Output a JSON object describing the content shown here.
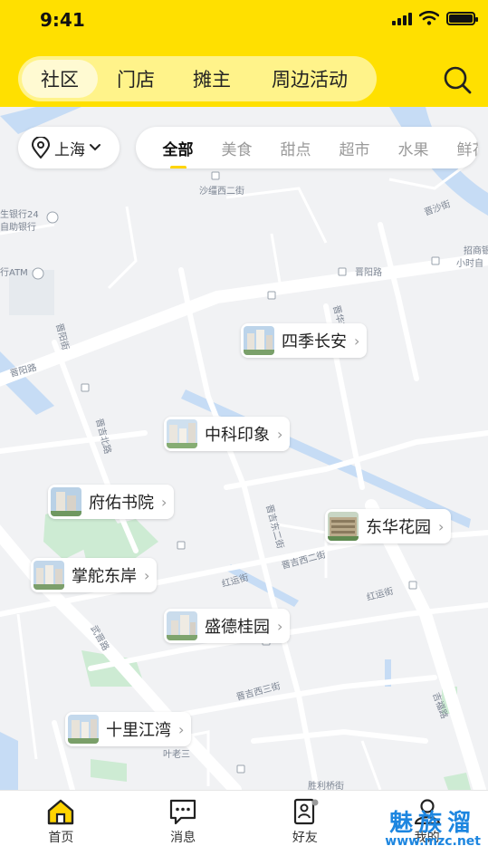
{
  "status_bar": {
    "time": "9:41"
  },
  "header": {
    "segments": [
      {
        "label": "社区",
        "active": true
      },
      {
        "label": "门店",
        "active": false
      },
      {
        "label": "摊主",
        "active": false
      },
      {
        "label": "周边活动",
        "active": false
      }
    ],
    "search_icon": "search-icon"
  },
  "filter": {
    "city": "上海",
    "categories": [
      "全部",
      "美食",
      "甜点",
      "超市",
      "水果",
      "鲜花"
    ],
    "active_category": "全部"
  },
  "map": {
    "street_labels": [
      "沙缰西二街",
      "生银行24",
      "自助银行",
      "行ATM",
      "晋阳路",
      "晋阳街",
      "晋吉北路",
      "晋沙街",
      "招商银",
      "小时自",
      "晋华街",
      "晋吉西二街",
      "红运街",
      "武晋路",
      "晋吉西三街",
      "叶老三",
      "胜利桥街",
      "吉福路",
      "晋吉东二街"
    ],
    "communities": [
      {
        "name": "四季长安"
      },
      {
        "name": "中科印象"
      },
      {
        "name": "府佑书院"
      },
      {
        "name": "东华花园"
      },
      {
        "name": "掌舵东岸"
      },
      {
        "name": "盛德桂园"
      },
      {
        "name": "十里江湾"
      }
    ]
  },
  "tabbar": {
    "items": [
      {
        "label": "首页",
        "icon": "home-icon",
        "active": true
      },
      {
        "label": "消息",
        "icon": "message-icon",
        "active": false
      },
      {
        "label": "好友",
        "icon": "contacts-icon",
        "active": false
      },
      {
        "label": "我的",
        "icon": "user-icon",
        "active": false
      }
    ]
  },
  "watermark": {
    "text": "魅族溜",
    "url": "www.mzc.net"
  },
  "colors": {
    "brand_yellow": "#ffe000",
    "segment_bg": "#fff38a",
    "water": "#c6dcf5",
    "park": "#cdebd3"
  }
}
